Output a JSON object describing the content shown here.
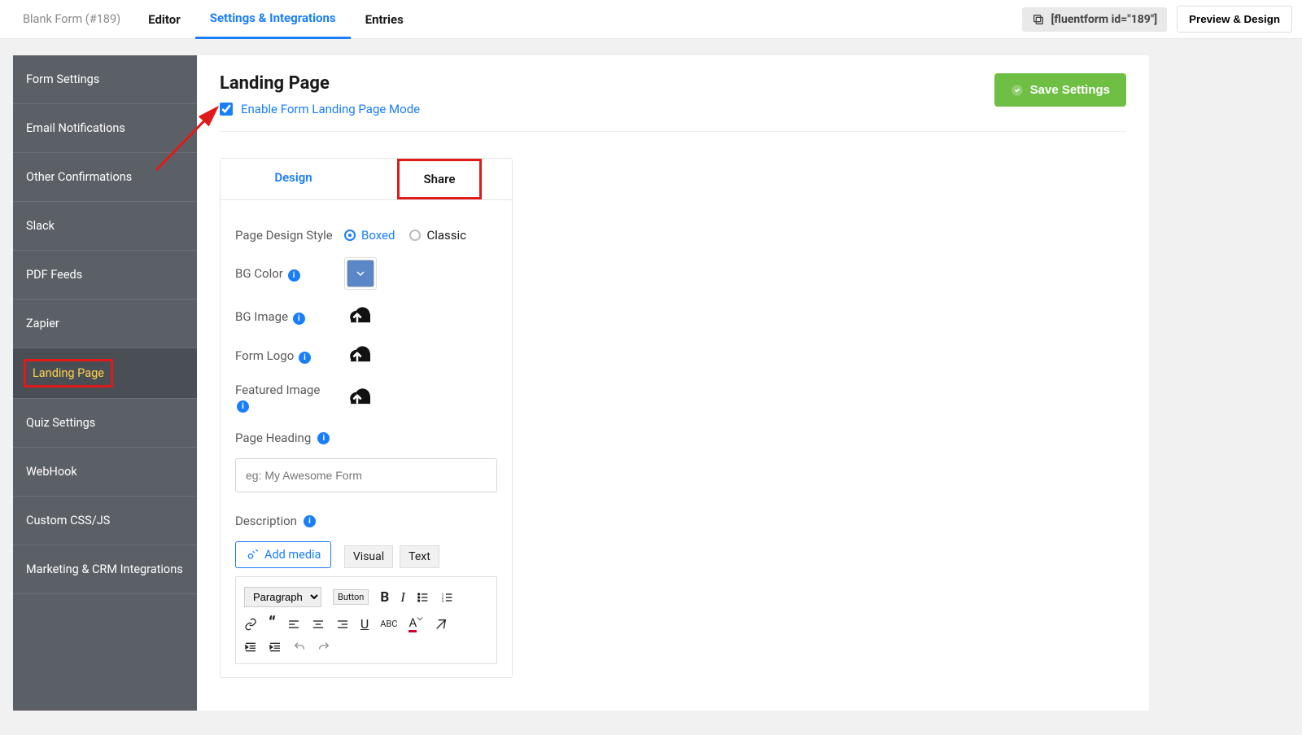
{
  "topbar": {
    "form_title": "Blank Form (#189)",
    "tabs": [
      "Editor",
      "Settings & Integrations",
      "Entries"
    ],
    "active_tab_index": 1,
    "shortcode": "[fluentform id=\"189\"]",
    "preview_btn": "Preview & Design"
  },
  "sidebar": {
    "items": [
      "Form Settings",
      "Email Notifications",
      "Other Confirmations",
      "Slack",
      "PDF Feeds",
      "Zapier",
      "Landing Page",
      "Quiz Settings",
      "WebHook",
      "Custom CSS/JS",
      "Marketing & CRM Integrations"
    ],
    "active_index": 6
  },
  "page": {
    "title": "Landing Page",
    "enable_label": "Enable Form Landing Page Mode",
    "enable_checked": true,
    "save_btn": "Save Settings"
  },
  "panel": {
    "tabs": [
      "Design",
      "Share"
    ],
    "active_tab_index": 0,
    "style_label": "Page Design Style",
    "style_options": [
      "Boxed",
      "Classic"
    ],
    "style_selected": 0,
    "bg_color_label": "BG Color",
    "bg_color_value": "#5B86C7",
    "bg_image_label": "BG Image",
    "form_logo_label": "Form Logo",
    "featured_image_label": "Featured Image",
    "page_heading_label": "Page Heading",
    "page_heading_placeholder": "eg: My Awesome Form",
    "description_label": "Description",
    "add_media_label": "Add media",
    "editor_tabs": [
      "Visual",
      "Text"
    ],
    "paragraph_label": "Paragraph",
    "button_label": "Button"
  }
}
